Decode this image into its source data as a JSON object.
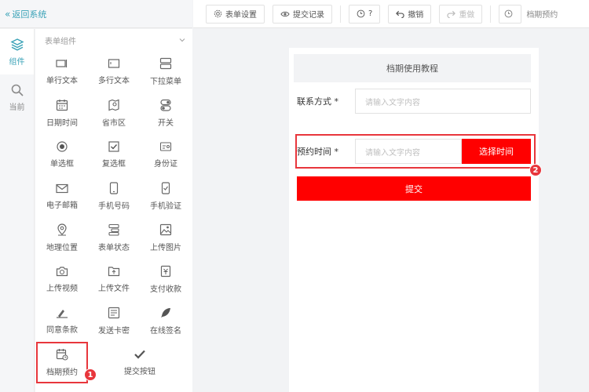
{
  "header": {
    "back_label": "返回系统"
  },
  "rail": {
    "items": [
      {
        "label": "组件"
      },
      {
        "label": "当前"
      }
    ]
  },
  "panel": {
    "title": "表单组件",
    "components": [
      {
        "label": "单行文本",
        "icon": "single-line-text-icon"
      },
      {
        "label": "多行文本",
        "icon": "multi-line-text-icon"
      },
      {
        "label": "下拉菜单",
        "icon": "dropdown-menu-icon"
      },
      {
        "label": "日期时间",
        "icon": "calendar-icon"
      },
      {
        "label": "省市区",
        "icon": "region-icon"
      },
      {
        "label": "开关",
        "icon": "toggle-icon"
      },
      {
        "label": "单选框",
        "icon": "radio-icon"
      },
      {
        "label": "复选框",
        "icon": "checkbox-icon"
      },
      {
        "label": "身份证",
        "icon": "id-card-icon"
      },
      {
        "label": "电子邮箱",
        "icon": "envelope-icon"
      },
      {
        "label": "手机号码",
        "icon": "mobile-icon"
      },
      {
        "label": "手机验证",
        "icon": "mobile-verify-icon"
      },
      {
        "label": "地理位置",
        "icon": "location-pin-icon"
      },
      {
        "label": "表单状态",
        "icon": "form-status-icon"
      },
      {
        "label": "上传图片",
        "icon": "image-icon"
      },
      {
        "label": "上传视频",
        "icon": "camera-icon"
      },
      {
        "label": "上传文件",
        "icon": "folder-icon"
      },
      {
        "label": "支付收款",
        "icon": "payment-icon"
      },
      {
        "label": "同意条款",
        "icon": "agreement-icon"
      },
      {
        "label": "发送卡密",
        "icon": "card-code-icon"
      },
      {
        "label": "在线签名",
        "icon": "feather-icon"
      },
      {
        "label": "档期预约",
        "icon": "schedule-icon"
      },
      {
        "label": "提交按钮",
        "icon": "checkmark-icon"
      }
    ]
  },
  "toolbar": {
    "form_settings": "表单设置",
    "submit_records": "提交记录",
    "help": "?",
    "undo": "撤销",
    "redo": "重做",
    "schedule_label": "档期预约"
  },
  "form": {
    "title": "档期使用教程",
    "contact_label": "联系方式 *",
    "contact_placeholder": "请输入文字内容",
    "reserve_label": "预约时间 *",
    "reserve_placeholder": "请输入文字内容",
    "pick_time": "选择时间",
    "submit": "提交"
  },
  "annotations": {
    "badge1": "1",
    "badge2": "2"
  },
  "colors": {
    "accent": "#3aa2b7",
    "primary_red": "#ff0000",
    "highlight_red": "#e8363c"
  }
}
